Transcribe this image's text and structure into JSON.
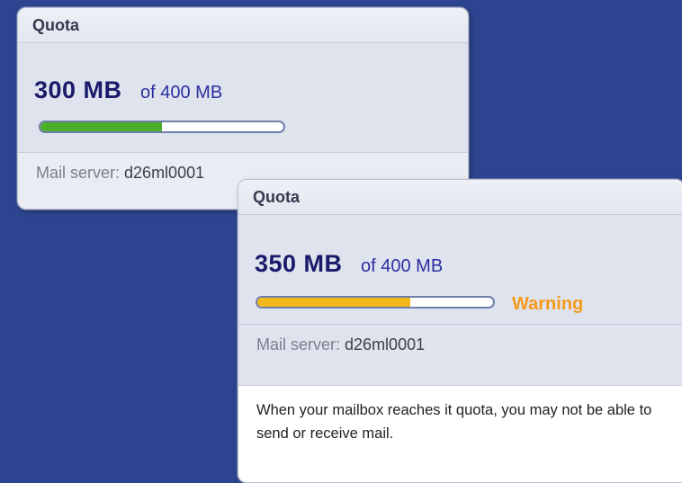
{
  "quota_panels": [
    {
      "title": "Quota",
      "used": "300 MB",
      "total": "of 400 MB",
      "usage_fraction": 0.5,
      "bar_color": "#4caf2a",
      "server_label": "Mail server:",
      "server_value": "d26ml0001",
      "warning": "",
      "note": ""
    },
    {
      "title": "Quota",
      "used": "350 MB",
      "total": "of 400 MB",
      "usage_fraction": 0.65,
      "bar_color": "#f2b819",
      "warning": "Warning",
      "warning_color": "#f59a1b",
      "server_label": "Mail server:",
      "server_value": "d26ml0001",
      "note": "When your mailbox reaches it quota, you may not be able to send or receive mail."
    }
  ]
}
